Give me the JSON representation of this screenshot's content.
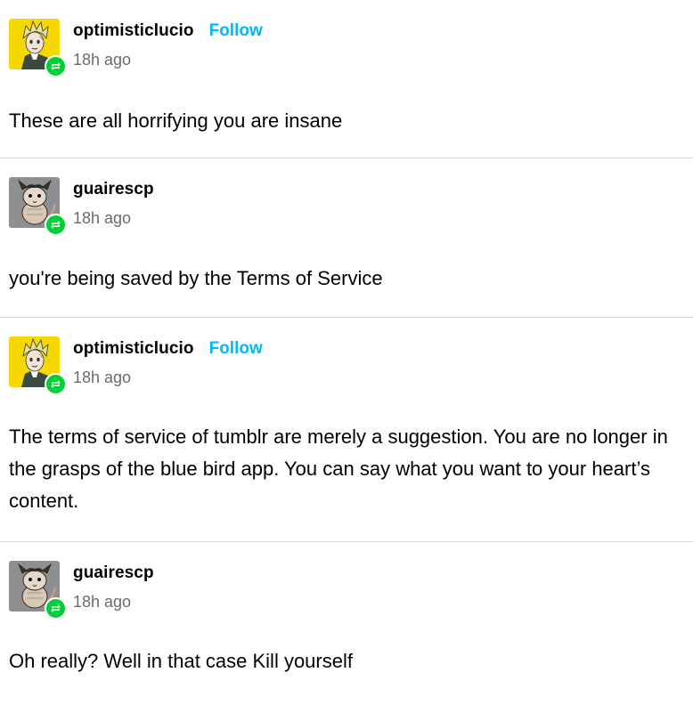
{
  "posts": [
    {
      "username": "optimisticlucio",
      "follow_label": "Follow",
      "show_follow": true,
      "time": "18h ago",
      "avatar": "blonde-character-avatar",
      "text": "These are all horrifying you are insane"
    },
    {
      "username": "guairescp",
      "follow_label": "",
      "show_follow": false,
      "time": "18h ago",
      "avatar": "rat-creature-avatar",
      "text": "you're being saved by the Terms of Service"
    },
    {
      "username": "optimisticlucio",
      "follow_label": "Follow",
      "show_follow": true,
      "time": "18h ago",
      "avatar": "blonde-character-avatar",
      "text": "The terms of service of tumblr are merely a suggestion. You are no longer in the grasps of the blue bird app. You can say what you want to your heart’s content."
    },
    {
      "username": "guairescp",
      "follow_label": "",
      "show_follow": false,
      "time": "18h ago",
      "avatar": "rat-creature-avatar",
      "text": "Oh really? Well in that case Kill yourself"
    }
  ],
  "colors": {
    "follow": "#00b8ff",
    "reblog_badge": "#00cf35",
    "divider": "#d9d9d9",
    "timestamp": "#6b6b6b",
    "avatar_yellow_bg": "#f5d800",
    "avatar_grey_bg": "#8f8f8f"
  },
  "icons": {
    "reblog": "reblog-icon"
  }
}
